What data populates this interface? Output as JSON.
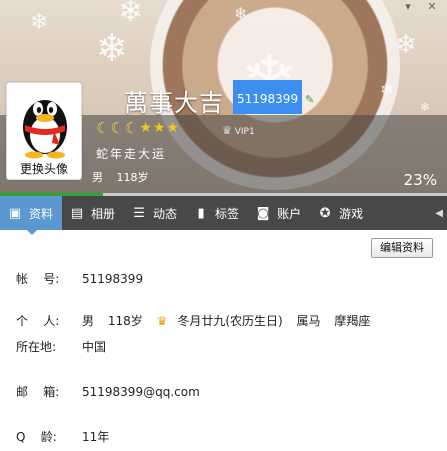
{
  "window": {
    "controls": [
      "▾",
      "✕"
    ]
  },
  "profile": {
    "nickname": "萬事大吉",
    "qq_number": "51198399",
    "signature": "蛇年走大运",
    "gender": "男",
    "age": "118岁",
    "change_avatar_label": "更换头像",
    "vip_label": "VIP1",
    "completion": "23%",
    "completion_fraction": 0.23,
    "level": {
      "moons": 3,
      "stars": 3
    }
  },
  "tabs": [
    {
      "label": "资料",
      "icon": "profile-card-icon"
    },
    {
      "label": "相册",
      "icon": "album-icon"
    },
    {
      "label": "动态",
      "icon": "feed-list-icon"
    },
    {
      "label": "标签",
      "icon": "bookmark-icon"
    },
    {
      "label": "账户",
      "icon": "briefcase-icon"
    },
    {
      "label": "游戏",
      "icon": "game-icon"
    }
  ],
  "buttons": {
    "edit_profile": "编辑资料"
  },
  "fields": {
    "account": {
      "label": "帐    号:",
      "value": "51198399"
    },
    "personal": {
      "label": "个    人:",
      "gender": "男",
      "age": "118岁",
      "birthday": "冬月廿九(农历生日)",
      "zodiac": "属马",
      "constellation": "摩羯座"
    },
    "location": {
      "label": "所在地:",
      "value": "中国"
    },
    "email": {
      "label": "邮    箱:",
      "value": "51198399@qq.com"
    },
    "q_age": {
      "label": "Q    龄:",
      "value": "11年"
    }
  },
  "colors": {
    "tab_active": "#5a98cf",
    "tab_bar": "#484848",
    "progress": "#27a832",
    "qq_highlight": "#3c8ff0"
  }
}
